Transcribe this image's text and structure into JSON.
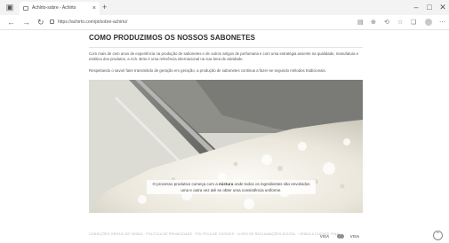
{
  "browser": {
    "tab_title": "Achlrto-sobre - Achlrto",
    "tab_close": "×",
    "new_tab": "+",
    "url": "https://achirto.com/pt/sobre-achirto/",
    "nav": {
      "back": "←",
      "forward": "→",
      "reload": "↻"
    },
    "window": {
      "minimize": "–",
      "maximize": "□",
      "close": "✕"
    }
  },
  "page": {
    "title": "COMO PRODUZIMOS OS NOSSOS SABONETES",
    "paragraph1": "Com mais de cem anos de experiência na produção de sabonetes e de outros artigos de perfumaria e com uma estratégia assente na qualidade, manufatura e estética dos produtos, a Ach. Brito é uma referência internacional na sua área de atividade.",
    "paragraph2": "Respeitando o savoir faire transmitido de geração em geração, a produção de sabonetes continua a fazer-se segundo métodos tradicionais.",
    "caption_pre": "O processo produtivo começa com a ",
    "caption_bold": "mistura",
    "caption_post": " onde todos os ingredientes são envolvidos uma e outra vez até se obter uma consistência uniforme."
  },
  "footer": {
    "links": "CONDIÇÕES GERAIS DE VENDA · POLÍTICA DE PRIVACIDADE · POLÍTICA DE COOKIES · LIVRO DE RECLAMAÇÕES DIGITAL · VENDA A CLIENTE FINAL",
    "payments": [
      "VISA",
      "VISA"
    ],
    "scroll_top": "⌃"
  }
}
